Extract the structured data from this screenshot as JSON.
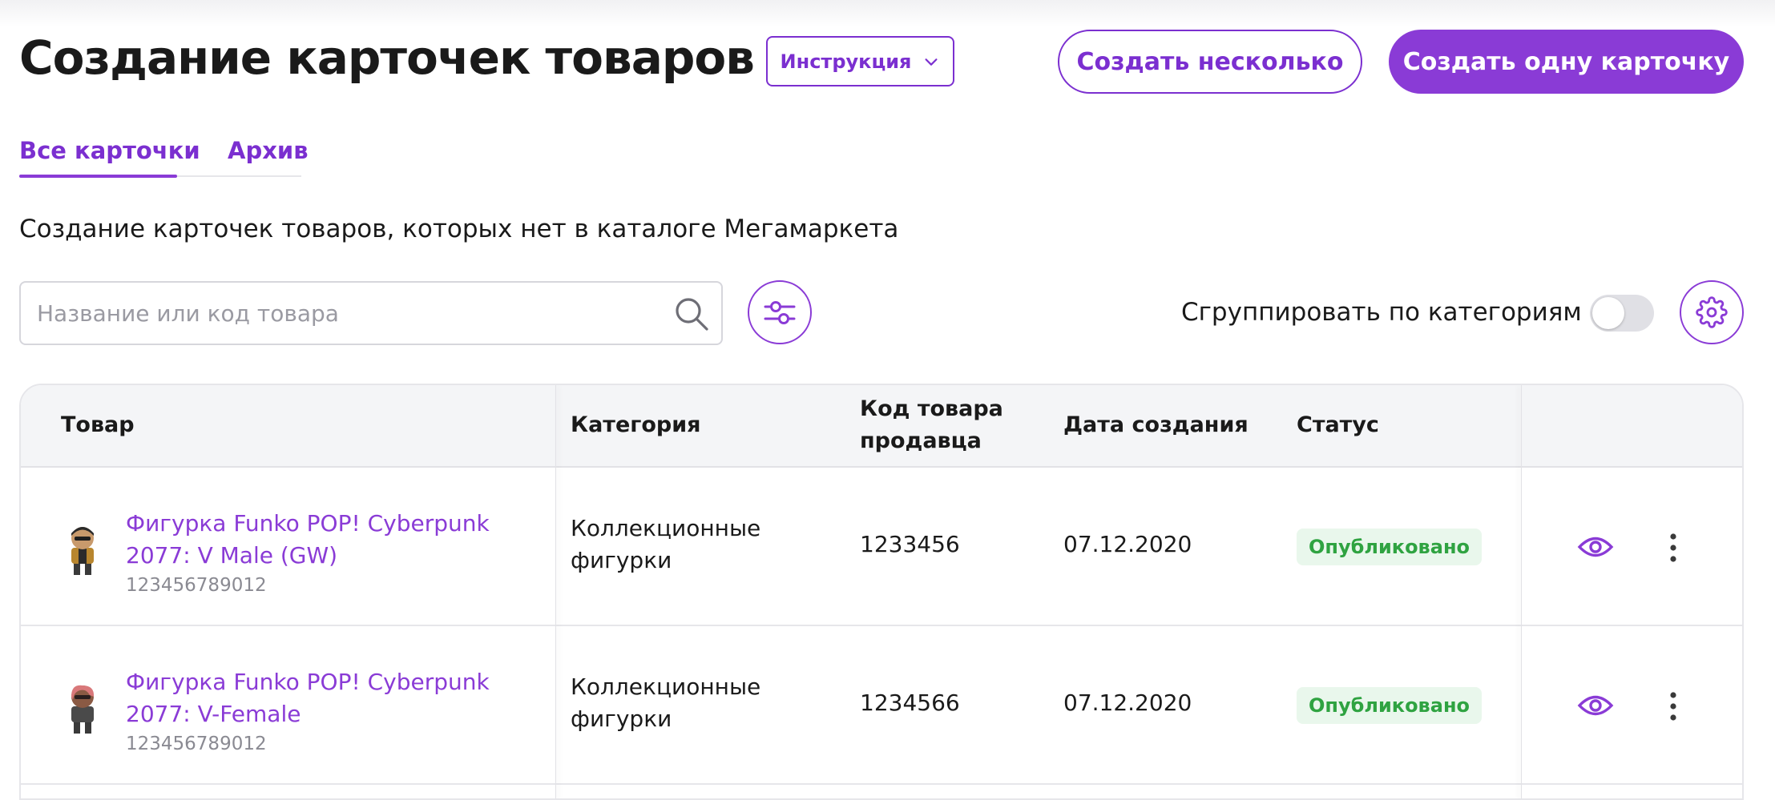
{
  "header": {
    "title": "Создание карточек товаров",
    "instructions_label": "Инструкция",
    "create_many_label": "Создать несколько",
    "create_one_label": "Создать одну карточку"
  },
  "tabs": [
    {
      "label": "Все карточки",
      "active": true
    },
    {
      "label": "Архив",
      "active": false
    }
  ],
  "subtitle": "Создание карточек товаров, которых нет в каталоге Мегамаркета",
  "search": {
    "placeholder": "Название или код товара",
    "value": ""
  },
  "group_toggle": {
    "label": "Сгруппировать по категориям",
    "enabled": false
  },
  "table": {
    "columns": {
      "product": "Товар",
      "category": "Категория",
      "seller_code_line1": "Код товара",
      "seller_code_line2": "продавца",
      "created": "Дата создания",
      "status": "Статус"
    },
    "rows": [
      {
        "name": "Фигурка Funko POP! Cyberpunk 2077: V Male (GW)",
        "code": "123456789012",
        "category": "Коллекционные фигурки",
        "seller_code": "1233456",
        "created": "07.12.2020",
        "status": "Опубликовано"
      },
      {
        "name": "Фигурка Funko POP! Cyberpunk 2077: V-Female",
        "code": "123456789012",
        "category": "Коллекционные фигурки",
        "seller_code": "1234566",
        "created": "07.12.2020",
        "status": "Опубликовано"
      }
    ]
  },
  "icons": {
    "instructions": "chevron-down-icon",
    "search": "search-icon",
    "filter": "sliders-icon",
    "settings": "gear-icon",
    "view": "eye-icon",
    "more": "more-vertical-icon"
  },
  "colors": {
    "accent": "#8a3bd6",
    "status_text": "#2fa341",
    "status_bg": "#e9f7ec",
    "header_bg": "#f4f5f7"
  }
}
